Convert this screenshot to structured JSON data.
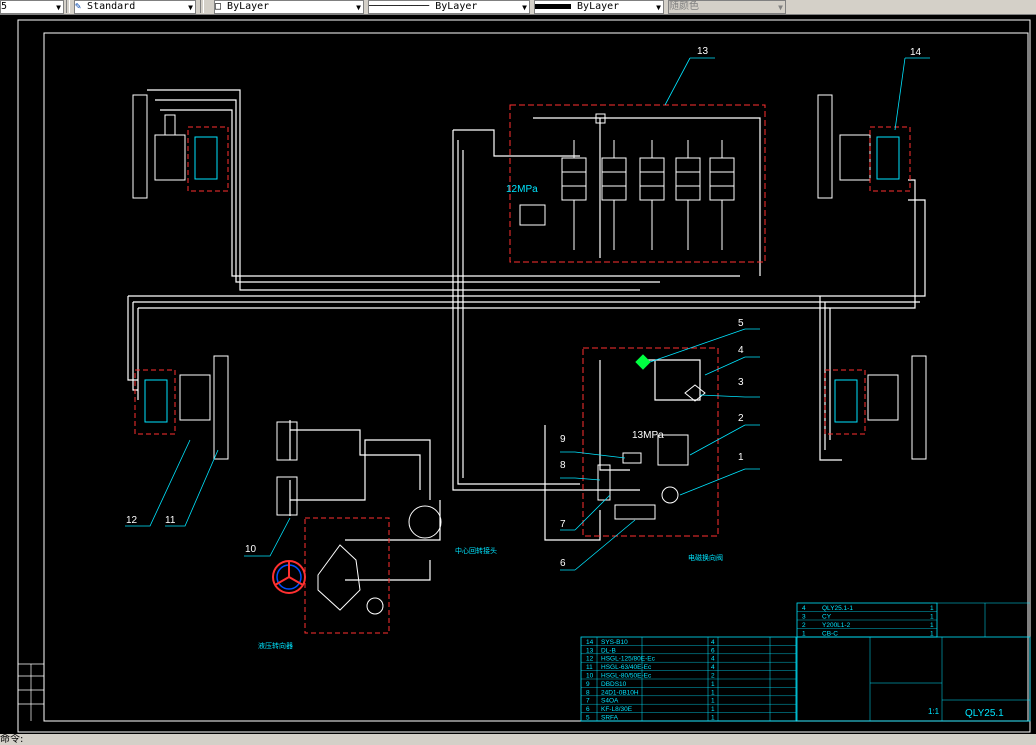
{
  "toolbar": {
    "style_value": "5",
    "textstyle_value": "Standard",
    "layer_color_value": "ByLayer",
    "linetype_value": "ByLayer",
    "lineweight_value": "ByLayer",
    "plotstyle_value": "随颜色"
  },
  "drawing": {
    "callouts": [
      "1",
      "2",
      "3",
      "4",
      "5",
      "6",
      "7",
      "8",
      "9",
      "10",
      "11",
      "12",
      "13",
      "14"
    ],
    "pressure_labels": [
      "12MPa",
      "13MPa"
    ],
    "small_labels": [
      "中心回转接头",
      "液压转向器",
      "电磁换向阀"
    ]
  },
  "parts_list": {
    "rows": [
      {
        "no": "14",
        "code": "SYS-B10",
        "qty": "4"
      },
      {
        "no": "13",
        "code": "DL-B",
        "qty": "6"
      },
      {
        "no": "12",
        "code": "HSGL-125/80E-Ec",
        "qty": "4"
      },
      {
        "no": "11",
        "code": "HSGL-63/40E-Ec",
        "qty": "4"
      },
      {
        "no": "10",
        "code": "HSGL-80/50E-Ec",
        "qty": "2"
      },
      {
        "no": "9",
        "code": "DBDS10",
        "qty": "1"
      },
      {
        "no": "8",
        "code": "24D1-0B10H",
        "qty": "1"
      },
      {
        "no": "7",
        "code": "S4OA",
        "qty": "1"
      },
      {
        "no": "6",
        "code": "KF-L8/30E",
        "qty": "1"
      },
      {
        "no": "5",
        "code": "SRFA",
        "qty": "1"
      }
    ],
    "rows2": [
      {
        "no": "4",
        "code": "QLY25.1-1",
        "qty": "1"
      },
      {
        "no": "3",
        "code": "CY",
        "qty": "1"
      },
      {
        "no": "2",
        "code": "Y200L1-2",
        "qty": "1"
      },
      {
        "no": "1",
        "code": "CB-C",
        "qty": "1"
      }
    ]
  },
  "title_block": {
    "drawing_number": "QLY25.1",
    "scale": "1:1"
  },
  "statusbar": {
    "command": "命令:"
  },
  "colors": {
    "white": "#ffffff",
    "cyan": "#00e5ff",
    "red": "#ff3030",
    "green": "#00ff40"
  }
}
